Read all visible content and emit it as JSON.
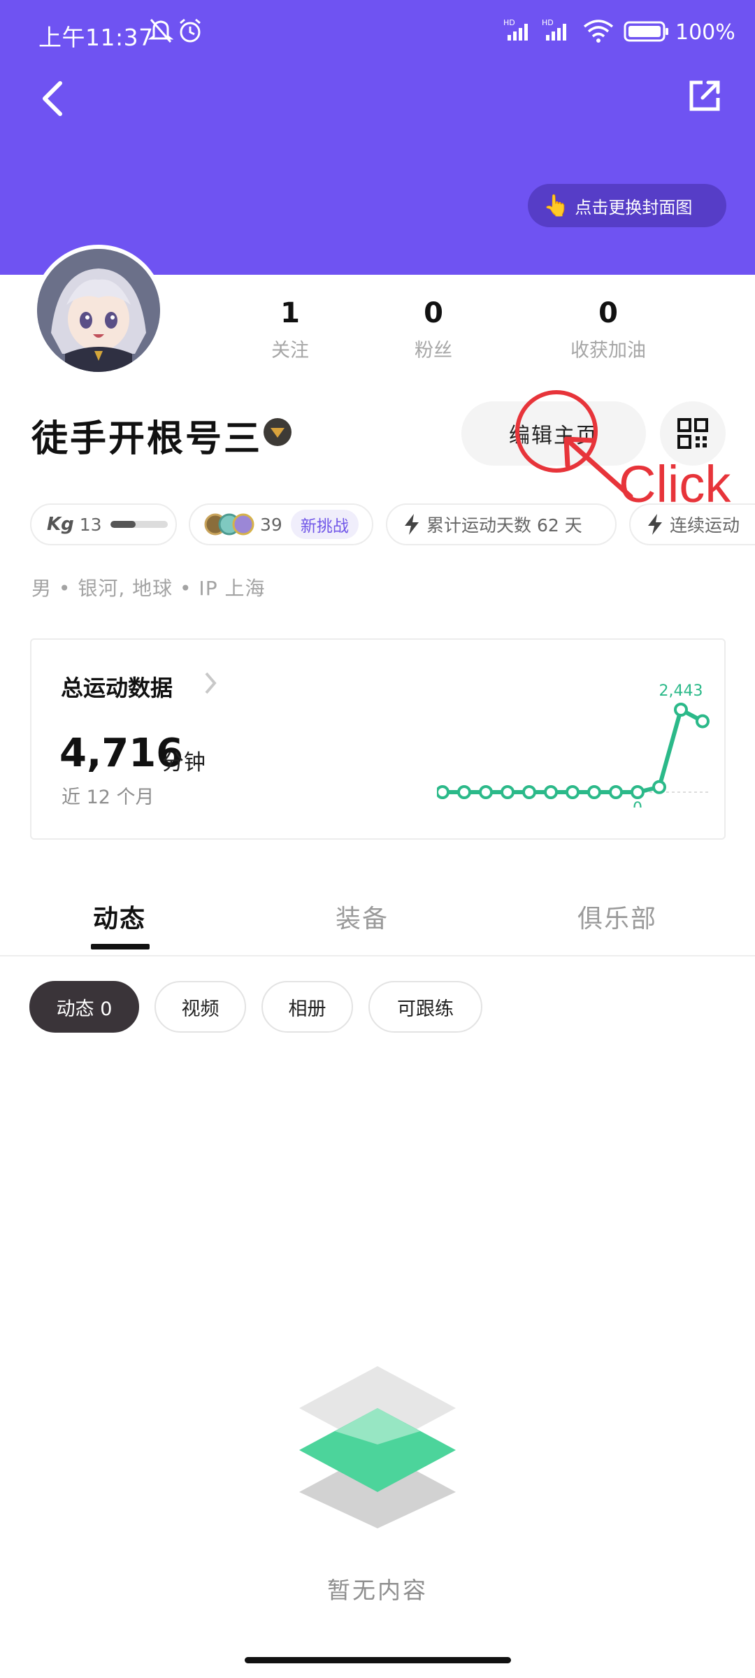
{
  "status_bar": {
    "time": "上午11:37",
    "battery": "100%"
  },
  "header": {
    "change_cover": "点击更换封面图",
    "background_color": "#6f53f2"
  },
  "profile": {
    "username": "徒手开根号三",
    "stats": [
      {
        "value": "1",
        "label": "关注"
      },
      {
        "value": "0",
        "label": "粉丝"
      },
      {
        "value": "0",
        "label": "收获加油"
      }
    ],
    "edit_label": "编辑主页",
    "annotation": "Click",
    "info_line": "男 • 银河, 地球 • IP 上海"
  },
  "badges": {
    "kg": {
      "label": "Kg",
      "value": "13",
      "progress": 0.45
    },
    "challenge": {
      "count": "39",
      "new_label": "新挑战"
    },
    "total_days": "累计运动天数 62 天",
    "streak": "连续运动"
  },
  "total_data": {
    "title": "总运动数据",
    "value": "4,716",
    "unit": "分钟",
    "period": "近 12 个月",
    "chart_data": {
      "type": "line",
      "values": [
        0,
        0,
        0,
        0,
        0,
        0,
        0,
        0,
        0,
        0,
        150,
        2443,
        2100
      ],
      "max_label": "2,443",
      "min_label": "0",
      "color": "#2bb989"
    }
  },
  "tabs": [
    "动态",
    "装备",
    "俱乐部"
  ],
  "filters": [
    "动态 0",
    "视频",
    "相册",
    "可跟练"
  ],
  "empty_state": "暂无内容"
}
